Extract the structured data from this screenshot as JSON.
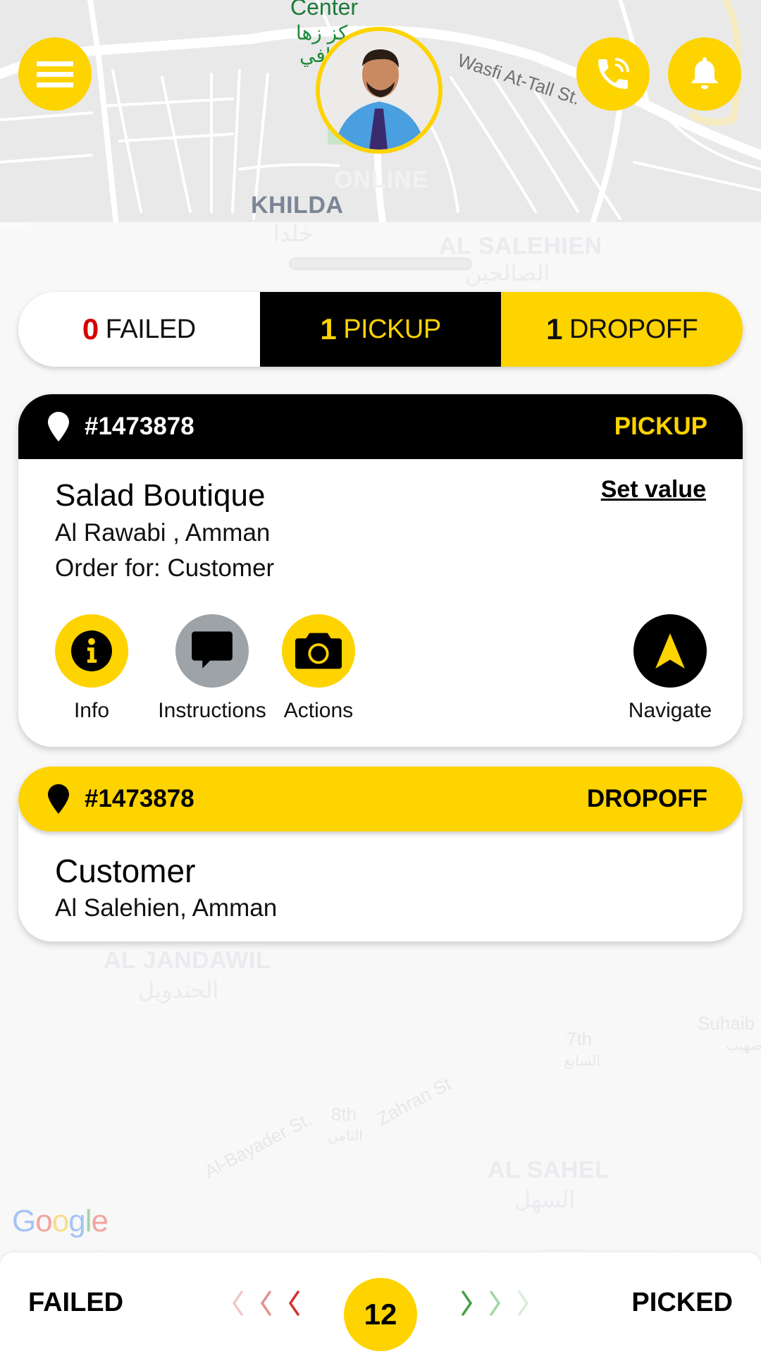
{
  "map": {
    "labels": {
      "poi_center": "Center",
      "poi_center_ar": "مركز زها",
      "poi_center_ar2": "الثقافي",
      "street_wasfi": "Wasfi At-Tall St.",
      "area_khilda": "KHILDA",
      "area_khilda_ar": "خلدا",
      "area_salehien": "AL SALEHIEN",
      "area_salehien_ar": "الصالحين",
      "area_jandawil": "AL JANDAWIL",
      "area_jandawil_ar": "الجندويل",
      "area_sahel": "AL SAHEL",
      "area_sahel_ar": "السهل",
      "street_zahran": "Zahran St",
      "street_bayader": "Al-Bayader St.",
      "circle_8th": "8th",
      "circle_8th_ar": "الثامن",
      "circle_7th": "7th",
      "circle_7th_ar": "السابع",
      "street_suhaib": "Suhaib",
      "street_suhaib_ar": "صهيب",
      "street_st": "St."
    },
    "attribution": "Google"
  },
  "header": {
    "menu_icon": "hamburger-menu-icon",
    "call_icon": "phone-call-icon",
    "bell_icon": "bell-icon",
    "driver_status": "ONLINE"
  },
  "summary": {
    "failed": {
      "count": "0",
      "label": "FAILED"
    },
    "pickup": {
      "count": "1",
      "label": "PICKUP"
    },
    "dropoff": {
      "count": "1",
      "label": "DROPOFF"
    }
  },
  "tasks": [
    {
      "order_id": "#1473878",
      "type": "PICKUP",
      "name": "Salad Boutique",
      "address": "Al Rawabi , Amman",
      "order_for": "Order for: Customer",
      "set_value_label": "Set value",
      "actions": [
        {
          "label": "Info",
          "icon": "info-icon"
        },
        {
          "label": "Instructions",
          "icon": "chat-bubble-icon"
        },
        {
          "label": "Actions",
          "icon": "camera-icon"
        },
        {
          "label": "Navigate",
          "icon": "navigate-arrow-icon"
        }
      ]
    },
    {
      "order_id": "#1473878",
      "type": "DROPOFF",
      "name": "Customer",
      "address": "Al Salehien, Amman"
    }
  ],
  "swipe_bar": {
    "left_label": "FAILED",
    "right_label": "PICKED",
    "counter": "12"
  },
  "colors": {
    "brand_yellow": "#fdd300",
    "black": "#000000",
    "failed_red": "#d50000",
    "success_green": "#4caf50",
    "neutral_gray": "#9ea3a8"
  }
}
